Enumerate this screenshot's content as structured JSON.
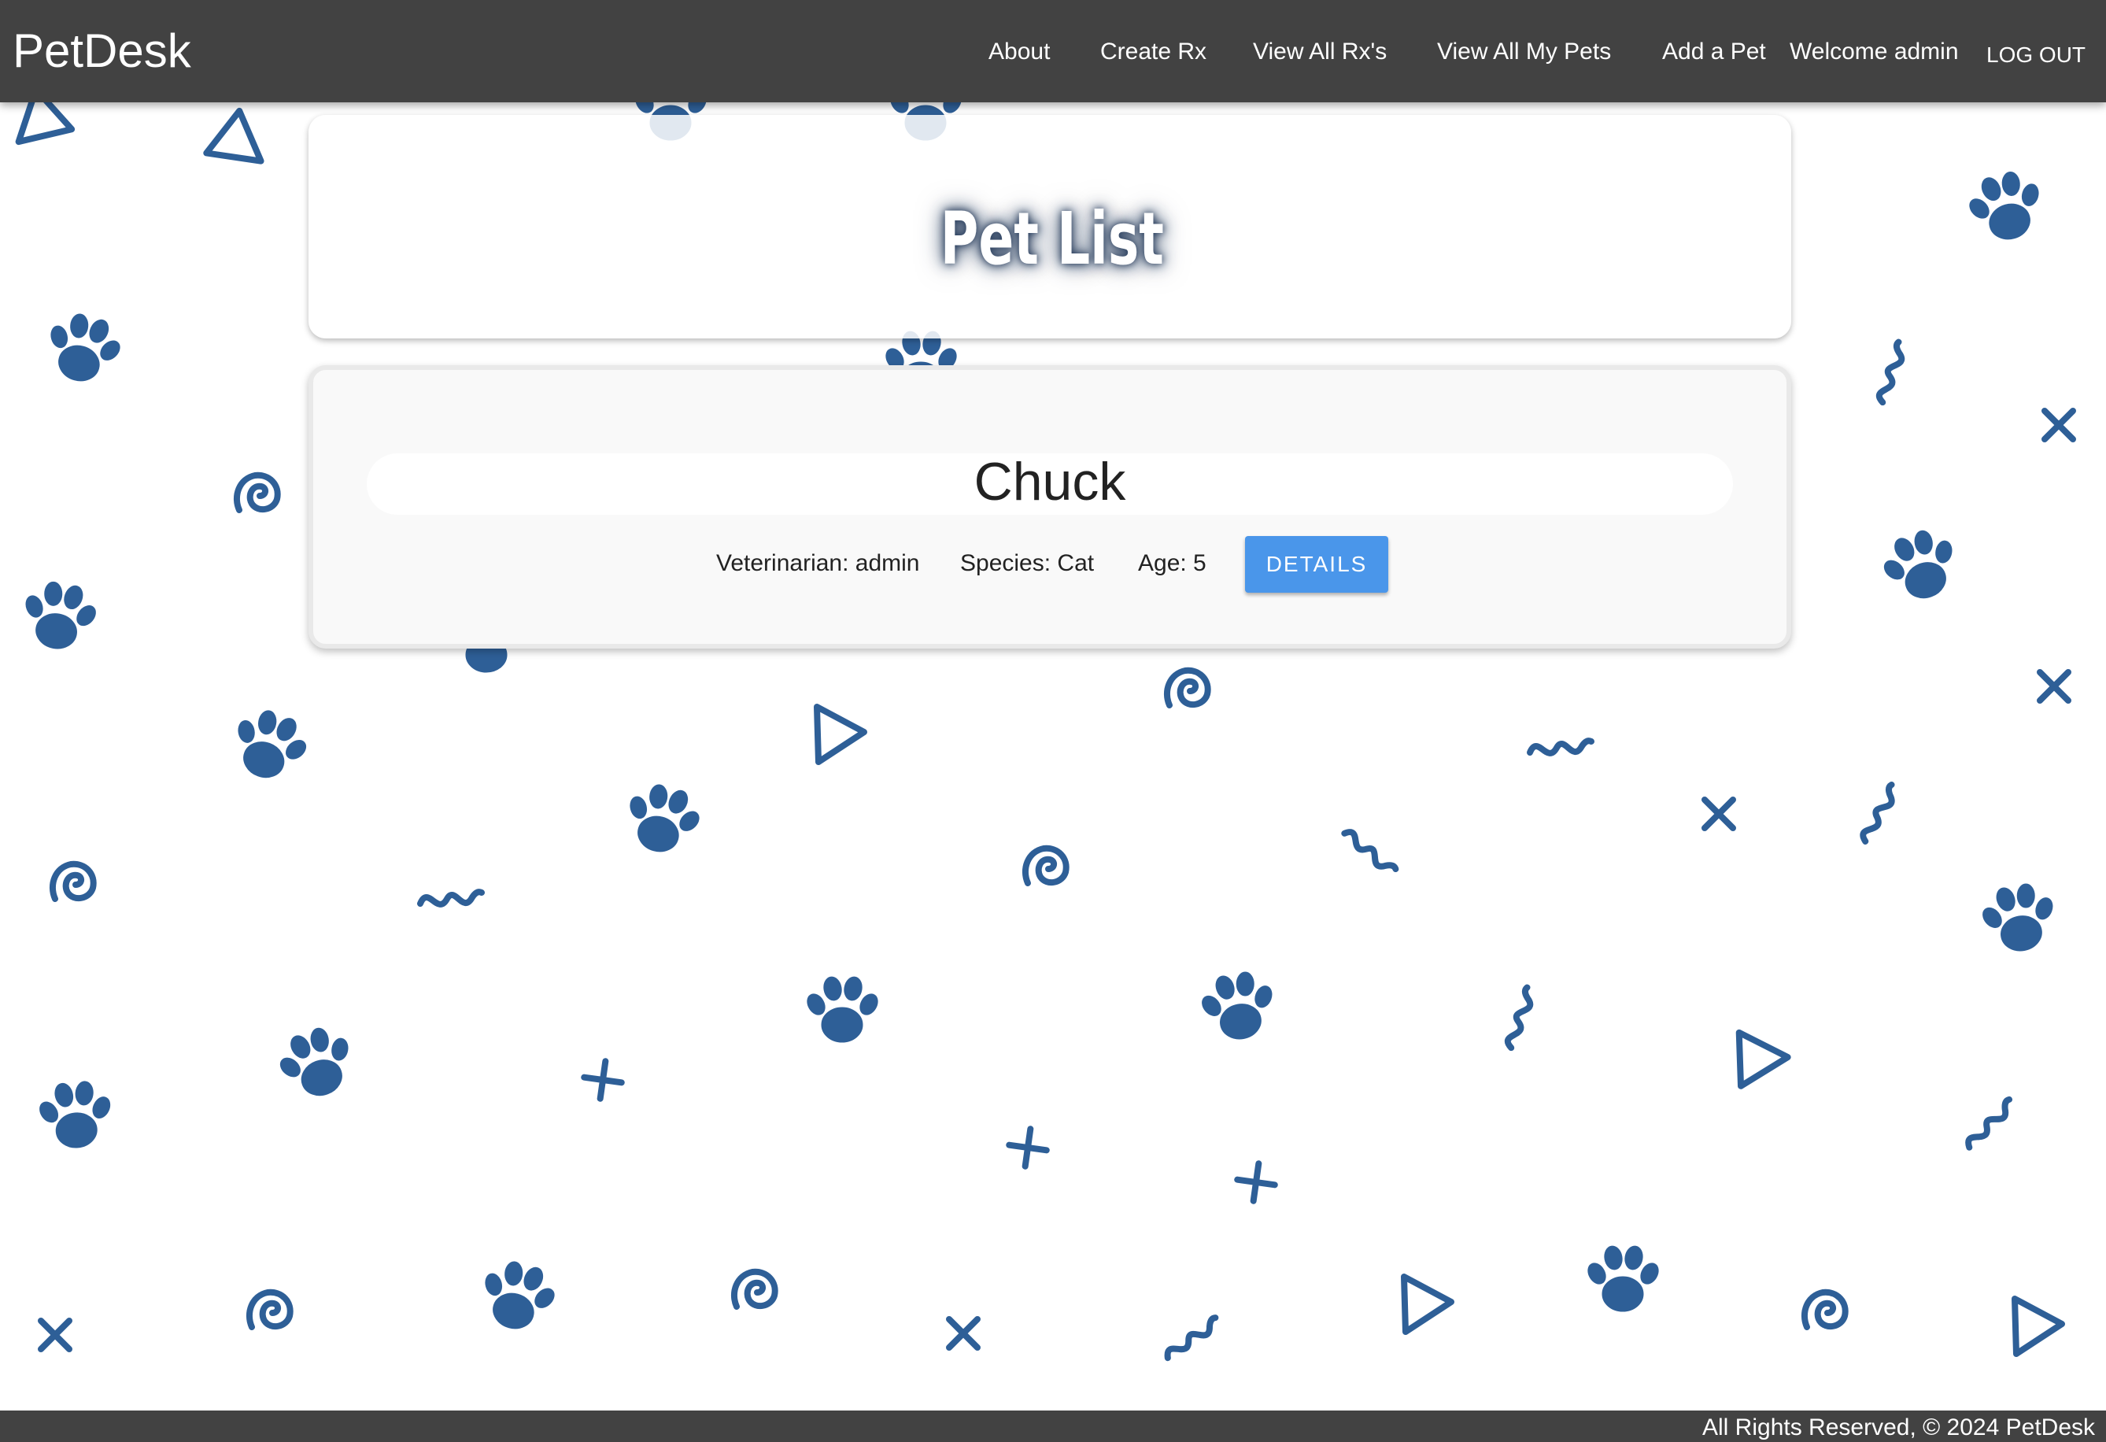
{
  "navbar": {
    "brand": "PetDesk",
    "links": {
      "about": "About",
      "create_rx": "Create Rx",
      "view_all_rx": "View All Rx's",
      "view_all_pets": "View All My Pets",
      "add_pet": "Add a Pet"
    },
    "welcome": "Welcome admin",
    "logout": "LOG OUT"
  },
  "page": {
    "title": "Pet List"
  },
  "pet": {
    "name": "Chuck",
    "veterinarian": "Veterinarian: admin",
    "species": "Species: Cat",
    "age": "Age: 5",
    "details_label": "DETAILS"
  },
  "footer": {
    "text": "All Rights Reserved, © 2024 PetDesk"
  },
  "colors": {
    "navbar": "#424242",
    "pattern": "#2e5f97",
    "button": "#4a96ea"
  },
  "background_icons": [
    "paw-print-icon",
    "triangle-icon",
    "spiral-icon",
    "squiggle-icon",
    "cross-icon",
    "plus-icon"
  ]
}
